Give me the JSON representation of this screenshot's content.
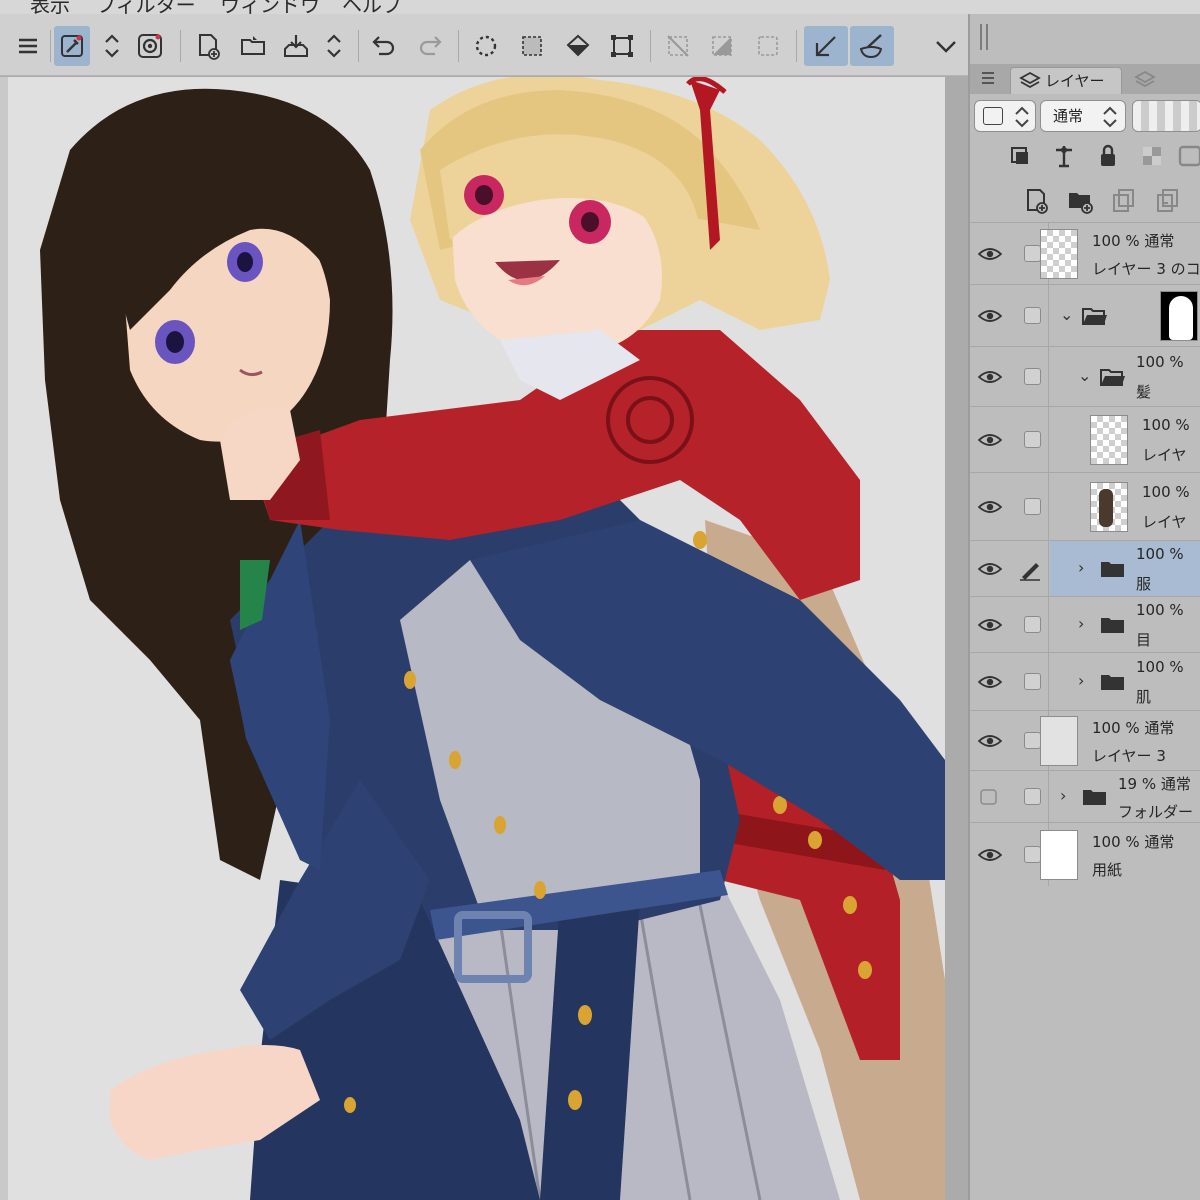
{
  "menu": {
    "items": [
      "表示",
      "フィルター",
      "ウィンドウ",
      "ヘルプ"
    ]
  },
  "toolbar": {
    "buttons": [
      "menu-icon",
      "eyedropper-icon",
      "up-down-arrows-icon",
      "spiral-icon",
      "new-canvas-icon",
      "open-folder-icon",
      "save-icon",
      "up-down-arrows-icon",
      "undo-icon",
      "redo-icon",
      "lasso-icon",
      "selection-icon",
      "fill-icon",
      "transform-icon",
      "deselect-icon",
      "invert-selection-icon",
      "select-all-icon",
      "pen-icon",
      "brush-icon",
      "chevron-down-icon"
    ]
  },
  "panel": {
    "tabs": [
      {
        "label": "レイヤー",
        "icon": "layers-icon"
      },
      {
        "label": "",
        "icon": "layer-property-icon"
      }
    ],
    "blend_mode": "通常",
    "layers": [
      {
        "opacity": "100 %",
        "mode": "通常",
        "name": "レイヤー 3 のコ",
        "visible": true,
        "thumb": "checker",
        "indent": 0
      },
      {
        "opacity": "",
        "mode": "",
        "name": "",
        "visible": true,
        "thumb": "mask",
        "folder": true,
        "expanded": true,
        "indent": 0
      },
      {
        "opacity": "100 %",
        "mode": "",
        "name": "髪",
        "visible": true,
        "folder": true,
        "expanded": true,
        "indent": 1
      },
      {
        "opacity": "100 %",
        "mode": "",
        "name": "レイヤ",
        "visible": true,
        "thumb": "checker",
        "indent": 2
      },
      {
        "opacity": "100 %",
        "mode": "",
        "name": "レイヤ",
        "visible": true,
        "thumb": "checker-figure",
        "indent": 2
      },
      {
        "opacity": "100 %",
        "mode": "",
        "name": "服",
        "visible": true,
        "folder": true,
        "expanded": false,
        "indent": 1,
        "selected": true
      },
      {
        "opacity": "100 %",
        "mode": "",
        "name": "目",
        "visible": true,
        "folder": true,
        "expanded": false,
        "indent": 1
      },
      {
        "opacity": "100 %",
        "mode": "",
        "name": "肌",
        "visible": true,
        "folder": true,
        "expanded": false,
        "indent": 1
      },
      {
        "opacity": "100 %",
        "mode": "通常",
        "name": "レイヤー 3",
        "visible": true,
        "thumb": "light",
        "indent": 0
      },
      {
        "opacity": "19 %",
        "mode": "通常",
        "name": "フォルダー",
        "visible": false,
        "folder": true,
        "expanded": false,
        "indent": 0
      },
      {
        "opacity": "100 %",
        "mode": "通常",
        "name": "用紙",
        "visible": true,
        "thumb": "white",
        "indent": 0
      }
    ]
  },
  "colors": {
    "toolbar_bg": "#d0d0d0",
    "canvas_bg": "#e0e0e0",
    "panel_bg": "#bdbdbd",
    "selection": "#a9bbd2"
  }
}
